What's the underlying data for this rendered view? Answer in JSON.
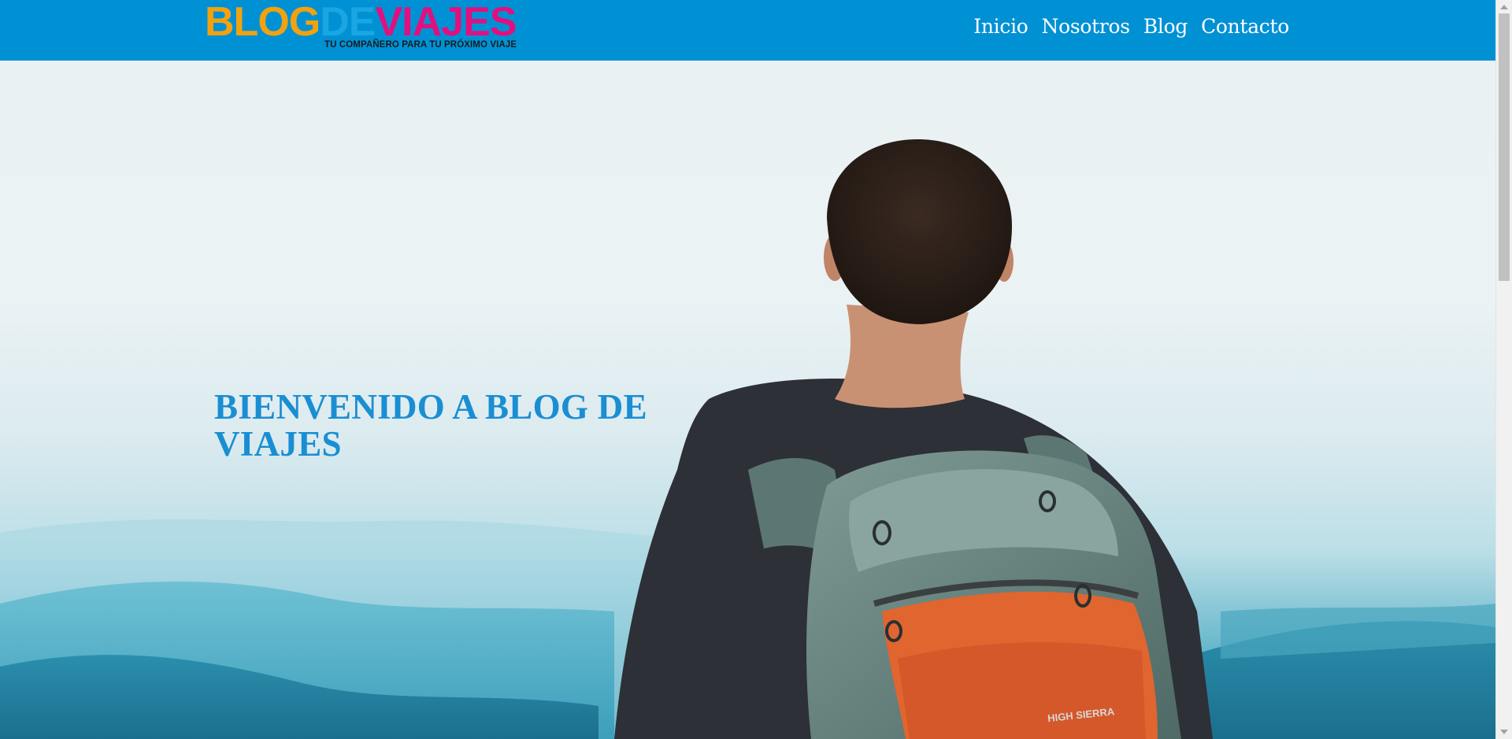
{
  "logo": {
    "part1": "BLOG",
    "part2": "DE",
    "part3": "VIAJES",
    "tagline": "TU COMPAÑERO PARA TU PRÓXIMO VIAJE"
  },
  "nav": {
    "items": [
      {
        "label": "Inicio"
      },
      {
        "label": "Nosotros"
      },
      {
        "label": "Blog"
      },
      {
        "label": "Contacto"
      }
    ]
  },
  "hero": {
    "title": "BIENVENIDO A BLOG DE VIAJES",
    "backpack_brand": "HIGH SIERRA"
  },
  "colors": {
    "header_bg": "#0091d5",
    "logo_blog": "#f2a20f",
    "logo_de": "#1aa5e3",
    "logo_viajes": "#e0117f",
    "hero_title": "#1a8ed3"
  },
  "icons": {
    "scroll_up": "triangle-up",
    "scroll_down": "triangle-down"
  }
}
